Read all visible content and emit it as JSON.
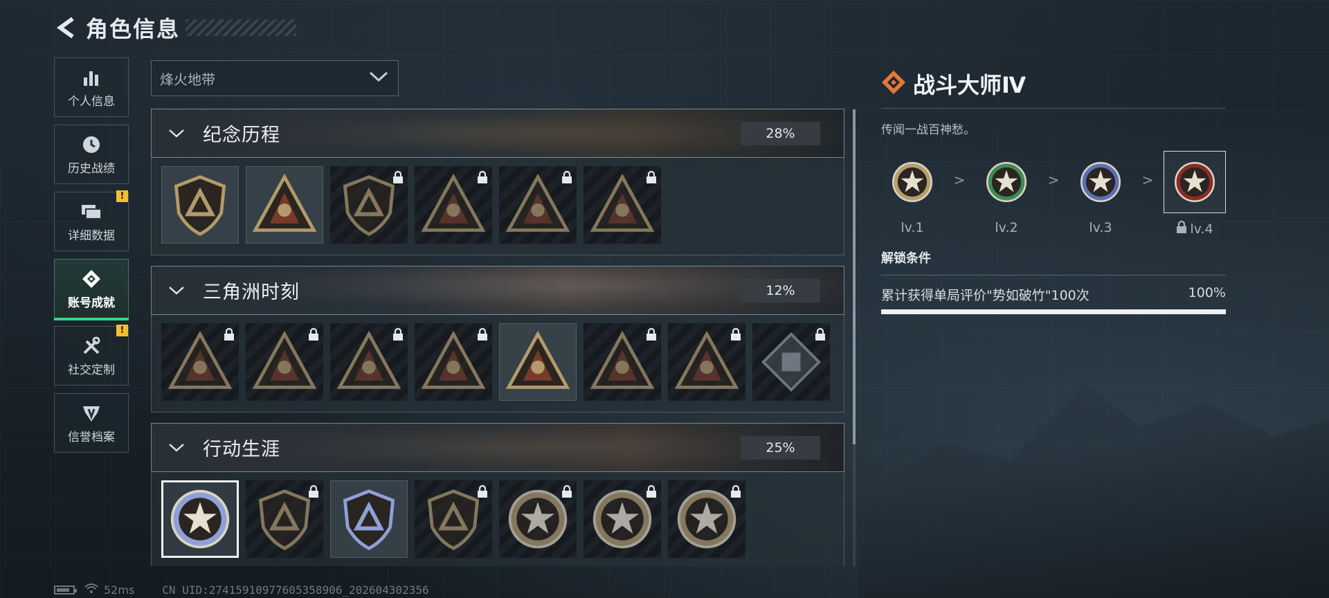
{
  "header": {
    "title": "角色信息"
  },
  "sidebar": {
    "items": [
      {
        "label": "个人信息",
        "icon": "bar-chart-icon",
        "badge": ""
      },
      {
        "label": "历史战绩",
        "icon": "clock-icon",
        "badge": ""
      },
      {
        "label": "详细数据",
        "icon": "folder-icon",
        "badge": "!"
      },
      {
        "label": "账号成就",
        "icon": "achievement-icon",
        "badge": "",
        "active": true
      },
      {
        "label": "社交定制",
        "icon": "tools-icon",
        "badge": "!"
      },
      {
        "label": "信誉档案",
        "icon": "credit-icon",
        "badge": ""
      }
    ]
  },
  "mode_select": {
    "value": "烽火地带"
  },
  "sections": [
    {
      "title": "纪念历程",
      "progress": "28%",
      "badges": [
        {
          "icon": "triangle-shield-badge-icon",
          "locked": false
        },
        {
          "icon": "helicopter-badge-icon",
          "locked": false
        },
        {
          "icon": "diamond-shield-badge-icon",
          "locked": true
        },
        {
          "icon": "skull-triangle-badge-icon",
          "locked": true
        },
        {
          "icon": "soldier-triangle-badge-icon",
          "locked": true
        },
        {
          "icon": "crossed-swords-triangle-badge-icon",
          "locked": true
        }
      ]
    },
    {
      "title": "三角洲时刻",
      "progress": "12%",
      "badges": [
        {
          "icon": "box-triangle-badge-icon",
          "locked": true
        },
        {
          "icon": "mask-triangle-badge-icon",
          "locked": true
        },
        {
          "icon": "runner-triangle-badge-icon",
          "locked": true
        },
        {
          "icon": "hand-triangle-badge-icon",
          "locked": true
        },
        {
          "icon": "squad-triangle-badge-icon",
          "locked": false
        },
        {
          "icon": "team-triangle-badge-icon",
          "locked": true
        },
        {
          "icon": "beast-triangle-badge-icon",
          "locked": true
        },
        {
          "icon": "cube-diamond-badge-icon",
          "locked": true
        }
      ]
    },
    {
      "title": "行动生涯",
      "progress": "25%",
      "badges": [
        {
          "icon": "star-round-badge-icon",
          "locked": false,
          "selected": true
        },
        {
          "icon": "chevron-shield-badge-icon",
          "locked": true
        },
        {
          "icon": "wings-shield-badge-icon",
          "locked": false
        },
        {
          "icon": "dice-shield-badge-icon",
          "locked": true
        },
        {
          "icon": "shell-round-badge-icon",
          "locked": true
        },
        {
          "icon": "crosshair-round-badge-icon",
          "locked": true
        },
        {
          "icon": "eye-round-badge-icon",
          "locked": true
        }
      ]
    }
  ],
  "detail": {
    "title": "战斗大师Ⅳ",
    "description": "传闻一战百神愁。",
    "levels": [
      {
        "label": "lv.1",
        "color": "#b89c6e",
        "locked": false
      },
      {
        "label": "lv.2",
        "color": "#3f8a55",
        "locked": false
      },
      {
        "label": "lv.3",
        "color": "#5b6fb8",
        "locked": false
      },
      {
        "label": "lv.4",
        "color": "#8c2a2a",
        "locked": true
      }
    ],
    "level_arrow": ">",
    "unlock_title": "解锁条件",
    "condition": {
      "text": "累计获得单局评价\"势如破竹\"100次",
      "progress": "100%",
      "fraction": 1.0
    }
  },
  "status": {
    "ping": "52ms",
    "uid": "CN UID:27415910977605358906_202604302356"
  },
  "colors": {
    "accent_green": "#39d48a",
    "warning": "#f2c12e",
    "title_icon": "#e8763a"
  }
}
